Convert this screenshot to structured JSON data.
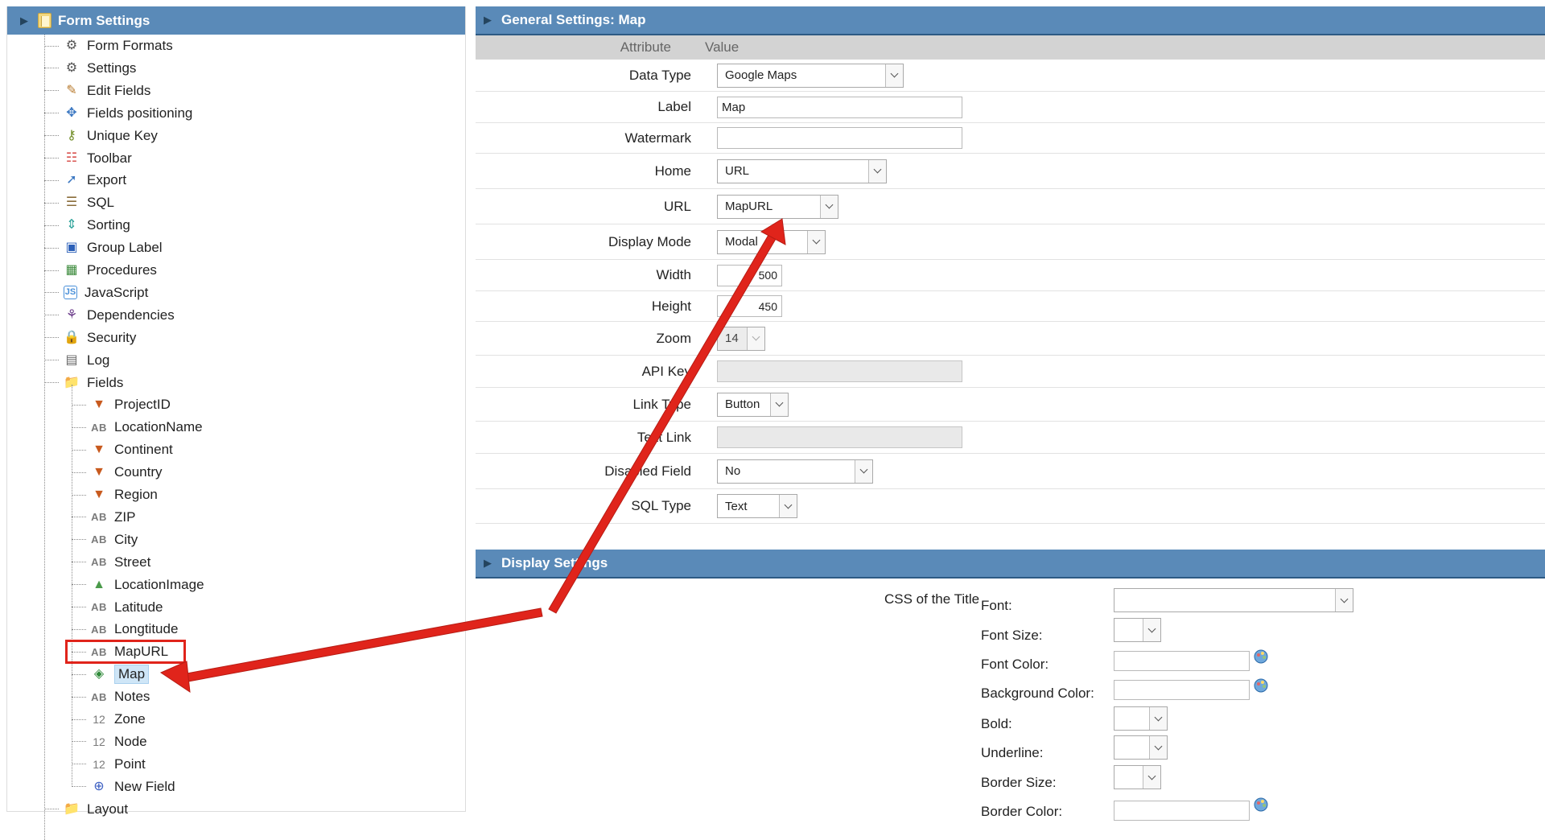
{
  "tree": {
    "title": "Form Settings",
    "items": [
      {
        "label": "Form Formats",
        "icon": "gear-icon",
        "glyph": "⚙",
        "color": "#555555"
      },
      {
        "label": "Settings",
        "icon": "gear-icon",
        "glyph": "⚙",
        "color": "#555555"
      },
      {
        "label": "Edit Fields",
        "icon": "pencil-icon",
        "glyph": "✎",
        "color": "#b7792c"
      },
      {
        "label": "Fields positioning",
        "icon": "move-icon",
        "glyph": "✥",
        "color": "#3c78c2"
      },
      {
        "label": "Unique Key",
        "icon": "key-icon",
        "glyph": "⚷",
        "color": "#6e8a22"
      },
      {
        "label": "Toolbar",
        "icon": "toolbar-icon",
        "glyph": "☷",
        "color": "#d9534f"
      },
      {
        "label": "Export",
        "icon": "export-icon",
        "glyph": "➚",
        "color": "#3c78c2"
      },
      {
        "label": "SQL",
        "icon": "database-icon",
        "glyph": "☰",
        "color": "#8a6d3b"
      },
      {
        "label": "Sorting",
        "icon": "sort-icon",
        "glyph": "⇕",
        "color": "#2aa198"
      },
      {
        "label": "Group Label",
        "icon": "group-label-icon",
        "glyph": "▣",
        "color": "#2b5fb8"
      },
      {
        "label": "Procedures",
        "icon": "procedures-icon",
        "glyph": "▦",
        "color": "#3b8a3b"
      },
      {
        "label": "JavaScript",
        "icon": "javascript-icon",
        "glyph": "JS",
        "color": "#4a90d9"
      },
      {
        "label": "Dependencies",
        "icon": "dependencies-icon",
        "glyph": "⚘",
        "color": "#6b3b8a"
      },
      {
        "label": "Security",
        "icon": "lock-icon",
        "glyph": "🔒",
        "color": "#c9a227"
      },
      {
        "label": "Log",
        "icon": "log-icon",
        "glyph": "▤",
        "color": "#666666"
      },
      {
        "label": "Fields",
        "icon": "folder-icon",
        "glyph": "📁",
        "color": "#c9a542"
      }
    ],
    "fields": [
      {
        "label": "ProjectID",
        "icon": "select-field-icon",
        "glyph": "▼",
        "color": "#c85a1e"
      },
      {
        "label": "LocationName",
        "icon": "text-field-icon",
        "glyph": "AB",
        "color": "#7a7a7a"
      },
      {
        "label": "Continent",
        "icon": "select-field-icon",
        "glyph": "▼",
        "color": "#c85a1e"
      },
      {
        "label": "Country",
        "icon": "select-field-icon",
        "glyph": "▼",
        "color": "#c85a1e"
      },
      {
        "label": "Region",
        "icon": "select-field-icon",
        "glyph": "▼",
        "color": "#c85a1e"
      },
      {
        "label": "ZIP",
        "icon": "text-field-icon",
        "glyph": "AB",
        "color": "#7a7a7a"
      },
      {
        "label": "City",
        "icon": "text-field-icon",
        "glyph": "AB",
        "color": "#7a7a7a"
      },
      {
        "label": "Street",
        "icon": "text-field-icon",
        "glyph": "AB",
        "color": "#7a7a7a"
      },
      {
        "label": "LocationImage",
        "icon": "image-field-icon",
        "glyph": "▲",
        "color": "#4a9a4a"
      },
      {
        "label": "Latitude",
        "icon": "text-field-icon",
        "glyph": "AB",
        "color": "#7a7a7a"
      },
      {
        "label": "Longtitude",
        "icon": "text-field-icon",
        "glyph": "AB",
        "color": "#7a7a7a"
      },
      {
        "label": "MapURL",
        "icon": "text-field-icon",
        "glyph": "AB",
        "color": "#7a7a7a"
      },
      {
        "label": "Map",
        "icon": "map-field-icon",
        "glyph": "◈",
        "color": "#2f8a3a"
      },
      {
        "label": "Notes",
        "icon": "text-field-icon",
        "glyph": "AB",
        "color": "#7a7a7a"
      },
      {
        "label": "Zone",
        "icon": "number-field-icon",
        "glyph": "12",
        "color": "#7a7a7a"
      },
      {
        "label": "Node",
        "icon": "number-field-icon",
        "glyph": "12",
        "color": "#7a7a7a"
      },
      {
        "label": "Point",
        "icon": "number-field-icon",
        "glyph": "12",
        "color": "#7a7a7a"
      },
      {
        "label": "New Field",
        "icon": "add-field-icon",
        "glyph": "⊕",
        "color": "#3c5fc2"
      }
    ],
    "after": {
      "label": "Layout",
      "icon": "folder-icon"
    }
  },
  "general": {
    "title": "General Settings: Map",
    "col_attribute": "Attribute",
    "col_value": "Value",
    "data_type": {
      "label": "Data Type",
      "value": "Google Maps"
    },
    "label": {
      "label": "Label",
      "value": "Map"
    },
    "watermark": {
      "label": "Watermark",
      "value": ""
    },
    "home": {
      "label": "Home",
      "value": "URL"
    },
    "url": {
      "label": "URL",
      "value": "MapURL"
    },
    "display_mode": {
      "label": "Display Mode",
      "value": "Modal"
    },
    "width": {
      "label": "Width",
      "value": "500"
    },
    "height": {
      "label": "Height",
      "value": "450"
    },
    "zoom": {
      "label": "Zoom",
      "value": "14"
    },
    "api_key": {
      "label": "API Key",
      "value": ""
    },
    "link_type": {
      "label": "Link Type",
      "value": "Button"
    },
    "text_link": {
      "label": "Text Link",
      "value": ""
    },
    "disabled_field": {
      "label": "Disabled Field",
      "value": "No"
    },
    "sql_type": {
      "label": "SQL Type",
      "value": "Text"
    }
  },
  "display": {
    "title": "Display Settings",
    "css_title": "CSS of the Title",
    "font": "Font:",
    "font_size": "Font Size:",
    "font_color": "Font Color:",
    "background_color": "Background Color:",
    "bold": "Bold:",
    "underline": "Underline:",
    "border_size": "Border Size:",
    "border_color": "Border Color:"
  },
  "colors": {
    "header": "#5a8ab8",
    "annotation": "#e0241b"
  }
}
